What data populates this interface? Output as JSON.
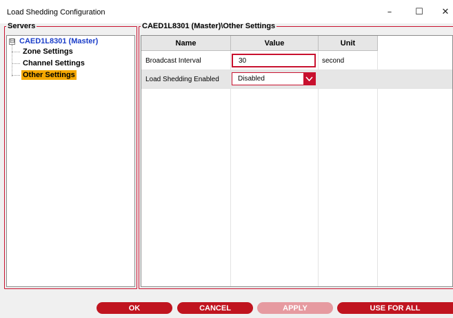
{
  "window": {
    "title": "Load Shedding Configuration",
    "controls": {
      "minimize": "–",
      "maximize": "☐",
      "close": "✕"
    }
  },
  "servers_panel": {
    "legend": "Servers",
    "tree": {
      "expander": "⊟",
      "root_label": "CAED1L8301 (Master)",
      "children": [
        {
          "label": "Zone Settings",
          "selected": false
        },
        {
          "label": "Channel Settings",
          "selected": false
        },
        {
          "label": "Other Settings",
          "selected": true
        }
      ]
    }
  },
  "settings_panel": {
    "legend": "CAED1L8301 (Master)\\Other Settings",
    "columns": [
      "Name",
      "Value",
      "Unit"
    ],
    "rows": [
      {
        "name": "Broadcast Interval",
        "value": "30",
        "unit": "second",
        "control": "text"
      },
      {
        "name": "Load Shedding Enabled",
        "value": "Disabled",
        "unit": "",
        "control": "dropdown"
      }
    ]
  },
  "buttons": {
    "ok": "OK",
    "cancel": "CANCEL",
    "apply": "APPLY",
    "use_for_all": "USE FOR ALL"
  },
  "colors": {
    "accent": "#c0141f",
    "accent_disabled": "#e69aa0",
    "selection": "#f5a800",
    "root_link": "#1a3dc8"
  }
}
